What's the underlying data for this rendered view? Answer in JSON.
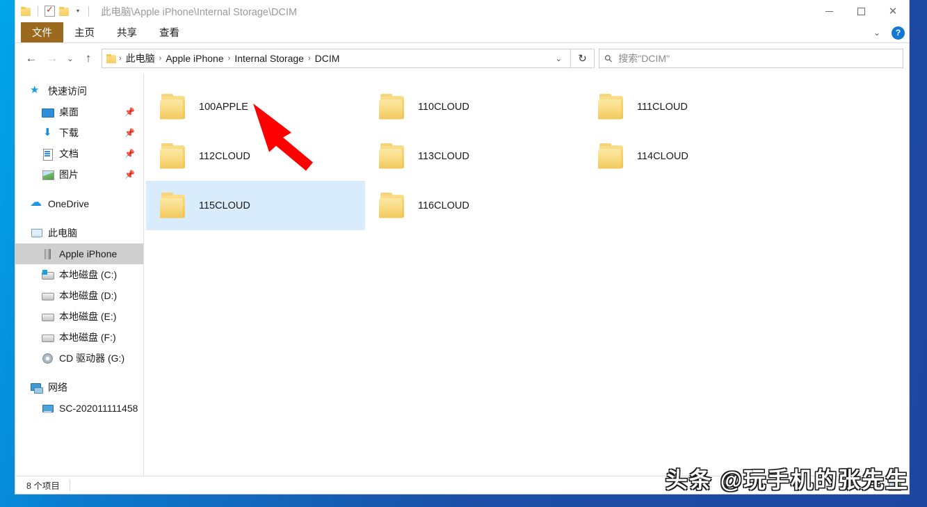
{
  "window": {
    "title_path": "此电脑\\Apple iPhone\\Internal Storage\\DCIM",
    "quick_access": {
      "folder_icon": "folder-icon",
      "properties_icon": "properties-checkbox-icon",
      "new_folder_icon": "new-folder-icon",
      "customize_caret": "▾"
    },
    "controls": {
      "minimize": "—",
      "maximize": "▢",
      "close": "✕"
    }
  },
  "ribbon": {
    "tabs": [
      {
        "label": "文件",
        "active": true
      },
      {
        "label": "主页",
        "active": false
      },
      {
        "label": "共享",
        "active": false
      },
      {
        "label": "查看",
        "active": false
      }
    ],
    "expand_caret": "⌄",
    "help_label": "?",
    "file_tab_color": "#9b6a1e"
  },
  "navigation": {
    "back": "←",
    "forward": "→",
    "recent": "⌄",
    "up": "↑",
    "refresh": "↻",
    "address_caret": "⌄",
    "breadcrumbs": [
      "此电脑",
      "Apple iPhone",
      "Internal Storage",
      "DCIM"
    ],
    "separator": "›"
  },
  "search": {
    "placeholder": "搜索\"DCIM\"",
    "icon": "search-icon"
  },
  "sidebar": {
    "groups": [
      {
        "header": {
          "label": "快速访问",
          "icon": "star-pin-icon"
        },
        "items": [
          {
            "label": "桌面",
            "icon": "desktop-icon",
            "pinned": true,
            "pin_glyph": "📌"
          },
          {
            "label": "下载",
            "icon": "download-icon",
            "pinned": true,
            "pin_glyph": "📌"
          },
          {
            "label": "文档",
            "icon": "documents-icon",
            "pinned": true,
            "pin_glyph": "📌"
          },
          {
            "label": "图片",
            "icon": "pictures-icon",
            "pinned": true,
            "pin_glyph": "📌"
          }
        ]
      },
      {
        "header": {
          "label": "OneDrive",
          "icon": "cloud-icon"
        },
        "items": []
      },
      {
        "header": {
          "label": "此电脑",
          "icon": "this-pc-icon"
        },
        "items": [
          {
            "label": "Apple iPhone",
            "icon": "phone-icon",
            "selected": true
          },
          {
            "label": "本地磁盘 (C:)",
            "icon": "system-drive-icon"
          },
          {
            "label": "本地磁盘 (D:)",
            "icon": "drive-icon"
          },
          {
            "label": "本地磁盘 (E:)",
            "icon": "drive-icon"
          },
          {
            "label": "本地磁盘 (F:)",
            "icon": "drive-icon"
          },
          {
            "label": "CD 驱动器 (G:)",
            "icon": "cd-drive-icon"
          }
        ]
      },
      {
        "header": {
          "label": "网络",
          "icon": "network-icon"
        },
        "items": [
          {
            "label": "SC-202011111458",
            "icon": "network-pc-icon"
          }
        ]
      }
    ]
  },
  "content": {
    "files": [
      {
        "name": "100APPLE",
        "icon": "folder-icon",
        "selected": false
      },
      {
        "name": "110CLOUD",
        "icon": "folder-icon",
        "selected": false
      },
      {
        "name": "111CLOUD",
        "icon": "folder-icon",
        "selected": false
      },
      {
        "name": "112CLOUD",
        "icon": "folder-icon",
        "selected": false
      },
      {
        "name": "113CLOUD",
        "icon": "folder-icon",
        "selected": false
      },
      {
        "name": "114CLOUD",
        "icon": "folder-icon",
        "selected": false
      },
      {
        "name": "115CLOUD",
        "icon": "folder-icon",
        "selected": true
      },
      {
        "name": "116CLOUD",
        "icon": "folder-icon",
        "selected": false
      }
    ],
    "annotation": {
      "type": "arrow",
      "color": "#ff0000",
      "points_to": "100APPLE"
    }
  },
  "status": {
    "item_count": "8 个项目",
    "view_details_icon": "details-view-icon",
    "view_thumbnails_icon": "thumbnail-view-icon"
  },
  "watermark": {
    "text": "头条 @玩手机的张先生"
  }
}
